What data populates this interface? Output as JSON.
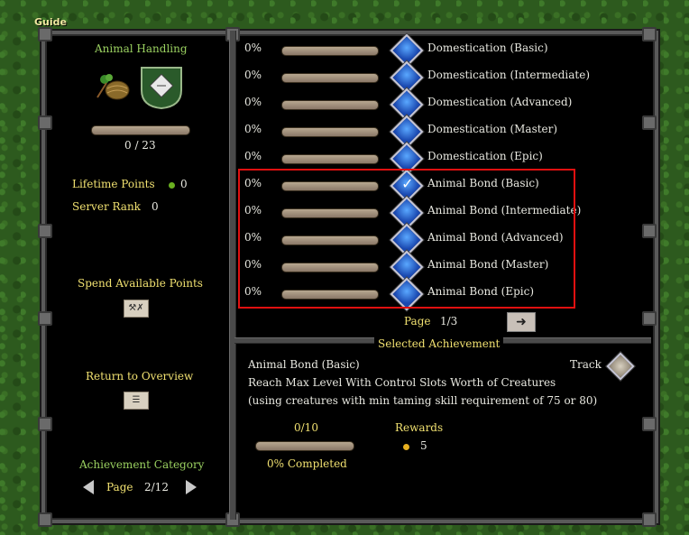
{
  "guide": {
    "label": "Guide"
  },
  "sidebar": {
    "category_title": "Animal Handling",
    "progress_text": "0 / 23",
    "progress_value": 0,
    "lifetime_points_label": "Lifetime Points",
    "lifetime_points_value": "0",
    "server_rank_label": "Server Rank",
    "server_rank_value": "0",
    "spend_label": "Spend Available Points",
    "return_label": "Return to Overview",
    "category_label": "Achievement Category",
    "page_label": "Page",
    "page_value": "2/12"
  },
  "achievements": [
    {
      "pct": "0%",
      "name": "Domestication (Basic)",
      "checked": false
    },
    {
      "pct": "0%",
      "name": "Domestication (Intermediate)",
      "checked": false
    },
    {
      "pct": "0%",
      "name": "Domestication (Advanced)",
      "checked": false
    },
    {
      "pct": "0%",
      "name": "Domestication (Master)",
      "checked": false
    },
    {
      "pct": "0%",
      "name": "Domestication (Epic)",
      "checked": false
    },
    {
      "pct": "0%",
      "name": "Animal Bond (Basic)",
      "checked": true
    },
    {
      "pct": "0%",
      "name": "Animal Bond (Intermediate)",
      "checked": false
    },
    {
      "pct": "0%",
      "name": "Animal Bond (Advanced)",
      "checked": false
    },
    {
      "pct": "0%",
      "name": "Animal Bond (Master)",
      "checked": false
    },
    {
      "pct": "0%",
      "name": "Animal Bond (Epic)",
      "checked": false
    }
  ],
  "list_pager": {
    "label": "Page",
    "value": "1/3"
  },
  "selected": {
    "header": "Selected Achievement",
    "title": "Animal Bond (Basic)",
    "track_label": "Track",
    "desc_line1": "Reach Max Level With Control Slots Worth of Creatures",
    "desc_line2": "(using creatures with min taming skill requirement of 75 or 80)",
    "progress_text": "0/10",
    "progress_value": 0,
    "completed_text": "0% Completed",
    "rewards_label": "Rewards",
    "rewards_value": "5"
  }
}
